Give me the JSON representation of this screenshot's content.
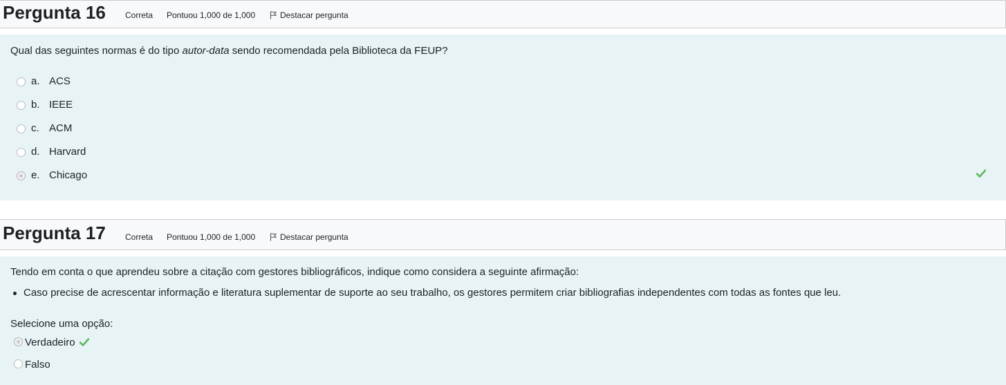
{
  "q16": {
    "title": "Pergunta 16",
    "status": "Correta",
    "score": "Pontuou 1,000 de 1,000",
    "flag_label": "Destacar pergunta",
    "text_before": "Qual das seguintes normas é do tipo ",
    "text_em": "autor-data",
    "text_after": " sendo recomendada pela Biblioteca da FEUP?",
    "answers": [
      {
        "letter": "a.",
        "label": "ACS",
        "selected": false
      },
      {
        "letter": "b.",
        "label": "IEEE",
        "selected": false
      },
      {
        "letter": "c.",
        "label": "ACM",
        "selected": false
      },
      {
        "letter": "d.",
        "label": "Harvard",
        "selected": false
      },
      {
        "letter": "e.",
        "label": "Chicago",
        "selected": true
      }
    ]
  },
  "q17": {
    "title": "Pergunta 17",
    "status": "Correta",
    "score": "Pontuou 1,000 de 1,000",
    "flag_label": "Destacar pergunta",
    "text": "Tendo em conta o que aprendeu sobre a citação com gestores bibliográficos, indique como considera a seguinte afirmação:",
    "statement": "Caso precise de acrescentar informação e literatura suplementar de suporte ao seu trabalho, os gestores permitem criar bibliografias independentes com todas as fontes que leu.",
    "prompt": "Selecione uma opção:",
    "options": [
      {
        "label": "Verdadeiro",
        "selected": true
      },
      {
        "label": "Falso",
        "selected": false
      }
    ]
  },
  "colors": {
    "correct_check": "#5cb85c",
    "panel_bg": "#e7f3f5",
    "header_bg": "#f8f9fa"
  },
  "icons": {
    "flag": "flag-icon",
    "check": "check-icon"
  }
}
